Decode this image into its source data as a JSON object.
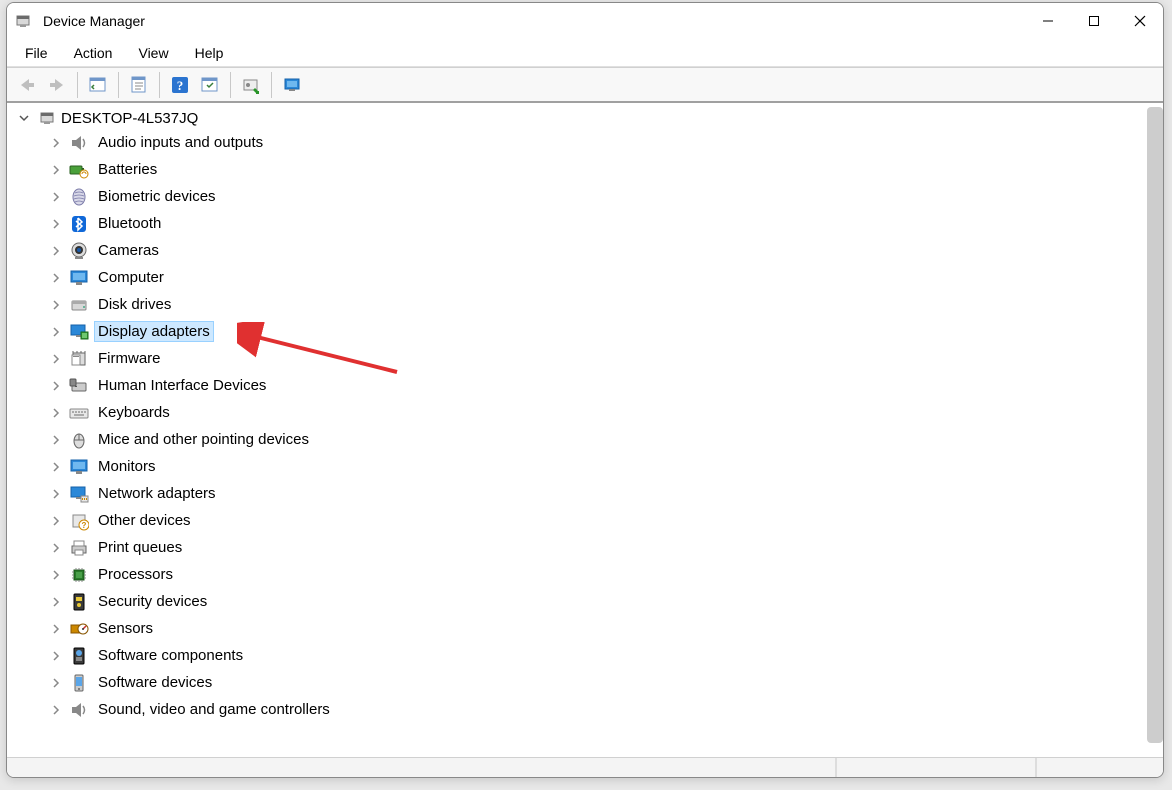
{
  "window": {
    "title": "Device Manager"
  },
  "menubar": {
    "items": [
      "File",
      "Action",
      "View",
      "Help"
    ]
  },
  "toolbar": {
    "buttons": [
      {
        "name": "back",
        "semantic": "back-arrow-icon"
      },
      {
        "name": "forward",
        "semantic": "forward-arrow-icon"
      },
      {
        "name": "sep"
      },
      {
        "name": "show-hidden",
        "semantic": "panel-icon"
      },
      {
        "name": "sep"
      },
      {
        "name": "properties-sheet",
        "semantic": "properties-icon"
      },
      {
        "name": "sep"
      },
      {
        "name": "help",
        "semantic": "help-icon"
      },
      {
        "name": "action-panel",
        "semantic": "panel2-icon"
      },
      {
        "name": "sep"
      },
      {
        "name": "update-driver",
        "semantic": "update-driver-icon"
      },
      {
        "name": "sep"
      },
      {
        "name": "scan-hardware",
        "semantic": "monitor-scan-icon"
      }
    ]
  },
  "tree": {
    "root": "DESKTOP-4L537JQ",
    "root_expanded": true,
    "selected_index": 7,
    "categories": [
      {
        "label": "Audio inputs and outputs",
        "icon": "speaker"
      },
      {
        "label": "Batteries",
        "icon": "battery"
      },
      {
        "label": "Biometric devices",
        "icon": "fingerprint"
      },
      {
        "label": "Bluetooth",
        "icon": "bluetooth"
      },
      {
        "label": "Cameras",
        "icon": "camera"
      },
      {
        "label": "Computer",
        "icon": "monitor"
      },
      {
        "label": "Disk drives",
        "icon": "disk"
      },
      {
        "label": "Display adapters",
        "icon": "display-adapter"
      },
      {
        "label": "Firmware",
        "icon": "firmware"
      },
      {
        "label": "Human Interface Devices",
        "icon": "hid"
      },
      {
        "label": "Keyboards",
        "icon": "keyboard"
      },
      {
        "label": "Mice and other pointing devices",
        "icon": "mouse"
      },
      {
        "label": "Monitors",
        "icon": "monitor"
      },
      {
        "label": "Network adapters",
        "icon": "network"
      },
      {
        "label": "Other devices",
        "icon": "other"
      },
      {
        "label": "Print queues",
        "icon": "printer"
      },
      {
        "label": "Processors",
        "icon": "processor"
      },
      {
        "label": "Security devices",
        "icon": "security"
      },
      {
        "label": "Sensors",
        "icon": "sensor"
      },
      {
        "label": "Software components",
        "icon": "software-comp"
      },
      {
        "label": "Software devices",
        "icon": "software-dev"
      },
      {
        "label": "Sound, video and game controllers",
        "icon": "speaker"
      }
    ]
  },
  "annotation": {
    "arrow_target": "Display adapters"
  }
}
